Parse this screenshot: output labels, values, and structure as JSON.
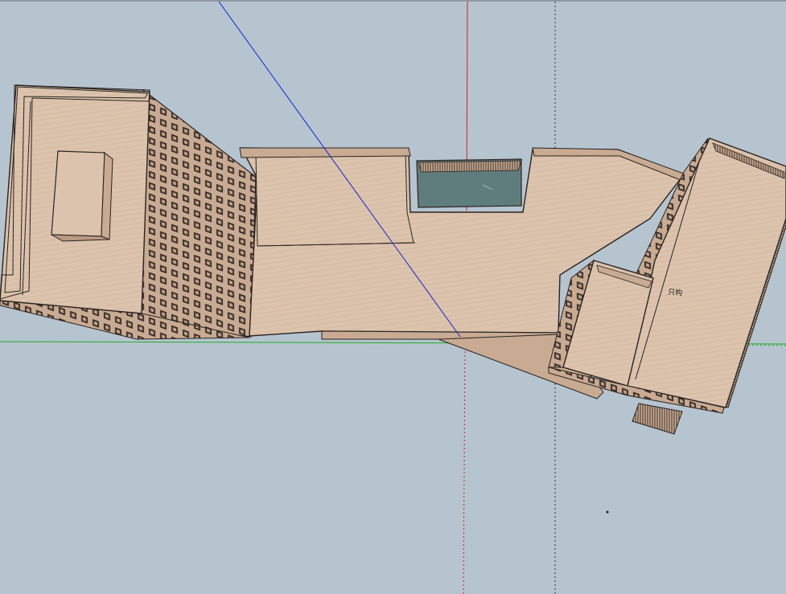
{
  "viewport": {
    "background": "#b6c4d0",
    "axis_colors": {
      "red": "#d02020",
      "green": "#22aa22",
      "blue": "#1a22cc"
    },
    "model_colors": {
      "roof": "#dcc3ad",
      "wall": "#c9ab93",
      "glass": "#5f7d7c",
      "edge": "#2a2420"
    }
  },
  "model": {
    "roof_annotation": "只构"
  }
}
